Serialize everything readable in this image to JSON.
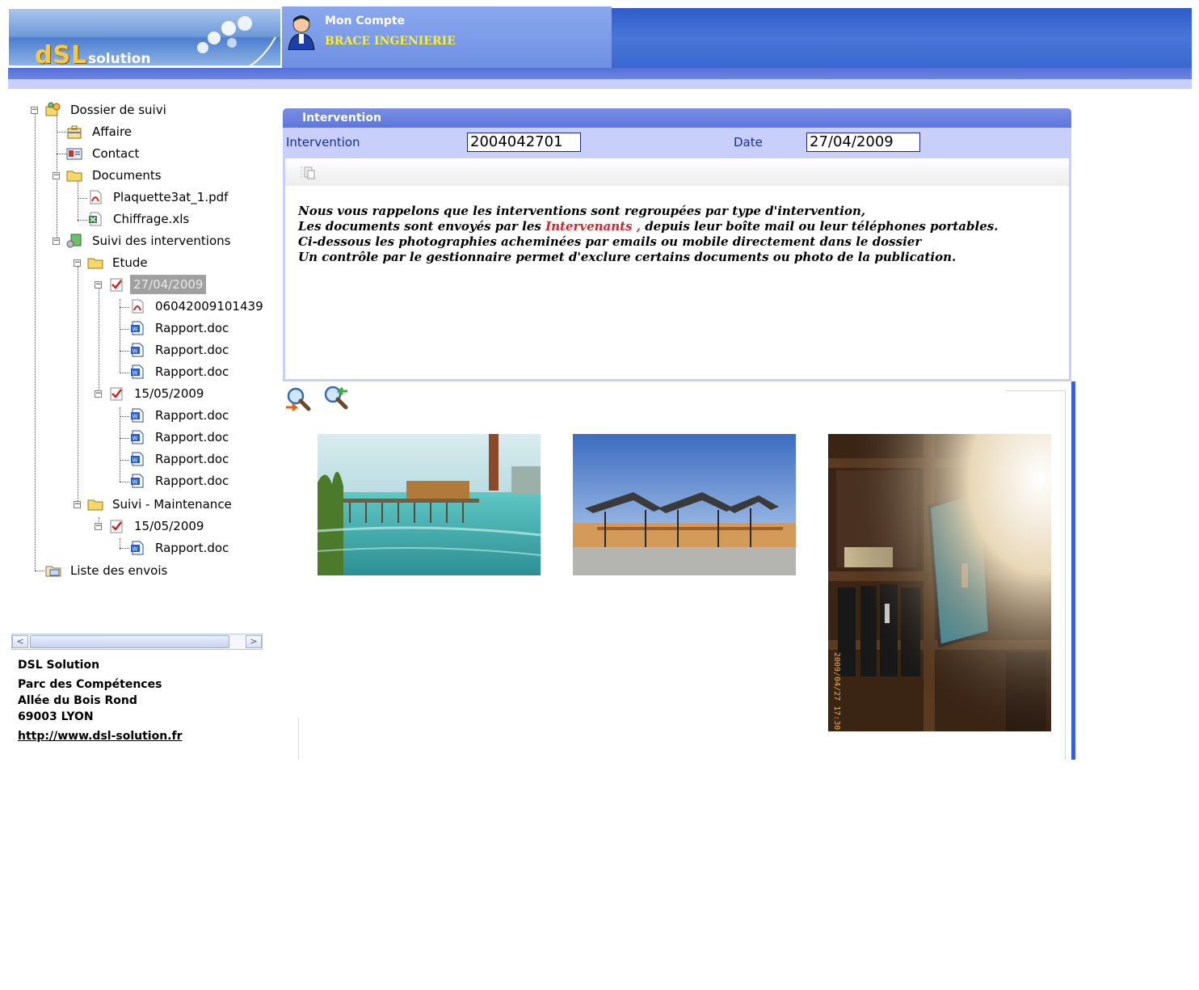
{
  "header": {
    "logo_text": "dSL",
    "logo_sub": "solution",
    "account_label": "Mon Compte",
    "account_name": "BRACE INGENIERIE"
  },
  "tree": {
    "root": "Dossier de suivi",
    "affaire": "Affaire",
    "contact": "Contact",
    "documents": "Documents",
    "doc1": "Plaquette3at_1.pdf",
    "doc2": "Chiffrage.xls",
    "suivi": "Suivi des interventions",
    "etude": "Etude",
    "date1": "27/04/2009",
    "file1": "06042009101439",
    "rapport": "Rapport.doc",
    "date2": "15/05/2009",
    "maintenance": "Suivi - Maintenance",
    "date3": "15/05/2009",
    "envois": "Liste des envois"
  },
  "footer": {
    "company": "DSL Solution",
    "line1": "Parc des Compétences",
    "line2": "Allée du Bois Rond",
    "line3": "69003 LYON",
    "url": "http://www.dsl-solution.fr"
  },
  "panel": {
    "title": "Intervention",
    "intervention_label": "Intervention",
    "intervention_value": "2004042701",
    "date_label": "Date",
    "date_value": "27/04/2009",
    "message": {
      "line1": "Nous vous rappelons que les interventions sont regroupées par type d'intervention,",
      "line2_a": "Les documents sont envoyés par les ",
      "line2_red": "Intervenants ,",
      "line2_b": " depuis leur boîte mail ou leur téléphones portables.",
      "line3": "Ci-dessous les photographies acheminées par emails ou mobile directement dans le dossier",
      "line4": "Un contrôle par le gestionnaire permet d'exclure certains documents ou photo de la publication."
    }
  },
  "gallery": {
    "photo3_stamp": "2009/04/27 17:30"
  },
  "colors": {
    "header_blue": "#3a66d0",
    "panel_title": "#6a82e0",
    "field_bg": "#c7cffa",
    "accent_yellow": "#ffee22",
    "red_text": "#e02020"
  }
}
